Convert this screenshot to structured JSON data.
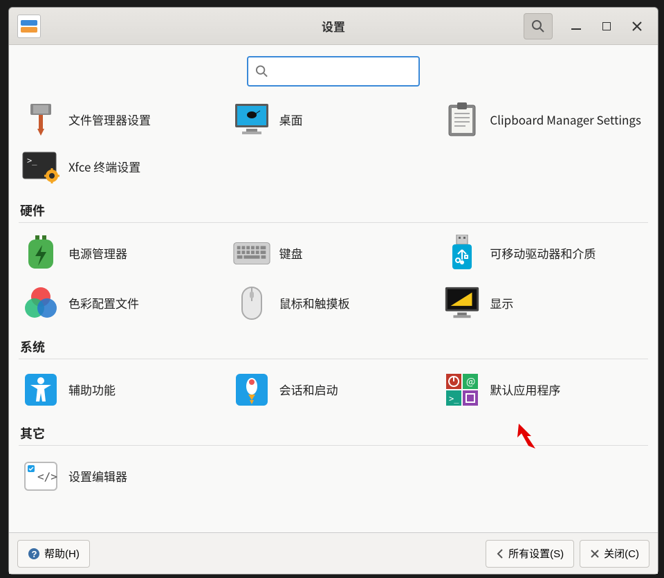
{
  "window": {
    "title": "设置"
  },
  "search": {
    "placeholder": ""
  },
  "top_row": {
    "items": [
      {
        "label": "文件管理器设置",
        "icon": "tool-icon"
      },
      {
        "label": "桌面",
        "icon": "desktop-icon"
      },
      {
        "label": "Clipboard Manager Settings",
        "icon": "clipboard-icon"
      }
    ]
  },
  "extra_row": {
    "items": [
      {
        "label": "Xfce 终端设置",
        "icon": "terminal-icon"
      }
    ]
  },
  "sections": [
    {
      "title": "硬件",
      "items": [
        {
          "label": "电源管理器",
          "icon": "power-icon"
        },
        {
          "label": "键盘",
          "icon": "keyboard-icon"
        },
        {
          "label": "可移动驱动器和介质",
          "icon": "usb-icon"
        },
        {
          "label": "色彩配置文件",
          "icon": "color-icon"
        },
        {
          "label": "鼠标和触摸板",
          "icon": "mouse-icon"
        },
        {
          "label": "显示",
          "icon": "display-icon"
        }
      ]
    },
    {
      "title": "系统",
      "items": [
        {
          "label": "辅助功能",
          "icon": "accessibility-icon"
        },
        {
          "label": "会话和启动",
          "icon": "session-icon"
        },
        {
          "label": "默认应用程序",
          "icon": "default-apps-icon"
        }
      ]
    },
    {
      "title": "其它",
      "items": [
        {
          "label": "设置编辑器",
          "icon": "editor-icon"
        }
      ]
    }
  ],
  "footer": {
    "help": "帮助(H)",
    "all_settings": "所有设置(S)",
    "close": "关闭(C)"
  }
}
